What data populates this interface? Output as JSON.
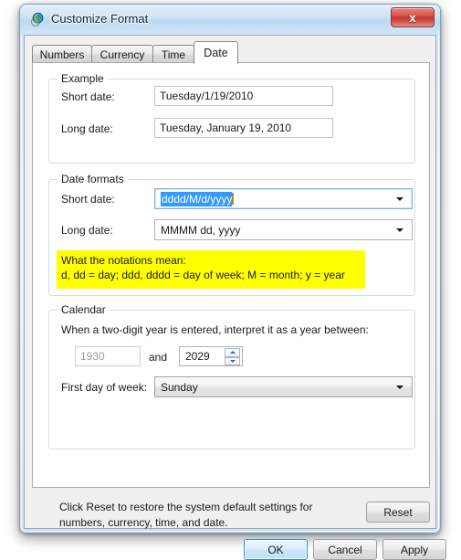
{
  "window": {
    "title": "Customize Format",
    "icon": "region-globe-icon",
    "close_label": "x"
  },
  "tabs": [
    {
      "label": "Numbers",
      "active": false
    },
    {
      "label": "Currency",
      "active": false
    },
    {
      "label": "Time",
      "active": false
    },
    {
      "label": "Date",
      "active": true
    }
  ],
  "example_group": {
    "title": "Example",
    "short_date_label": "Short date:",
    "short_date_value": "Tuesday/1/19/2010",
    "long_date_label": "Long date:",
    "long_date_value": "Tuesday, January 19, 2010"
  },
  "date_formats_group": {
    "title": "Date formats",
    "short_date_label": "Short date:",
    "short_date_value": "dddd/M/d/yyyy",
    "short_date_selected": true,
    "long_date_label": "Long date:",
    "long_date_value": "MMMM dd, yyyy",
    "notations_title": "What the notations mean:",
    "notations_body": "d, dd = day;  ddd, dddd = day of week;  M = month;  y = year",
    "highlight_color": "#ffff00"
  },
  "calendar_group": {
    "title": "Calendar",
    "two_digit_year_label": "When a two-digit year is entered, interpret it as a year between:",
    "year_from": "1930",
    "and_label": "and",
    "year_to": "2029",
    "first_day_label": "First day of week:",
    "first_day_value": "Sunday"
  },
  "footer": {
    "reset_description": "Click Reset to restore the system default settings for numbers, currency, time, and date.",
    "reset_label": "Reset",
    "ok_label": "OK",
    "cancel_label": "Cancel",
    "apply_label": "Apply"
  },
  "colors": {
    "selection_blue": "#3399ff",
    "highlight_yellow": "#ffff00",
    "close_red": "#bf3730",
    "default_button_blue": "#2c8ad4"
  }
}
